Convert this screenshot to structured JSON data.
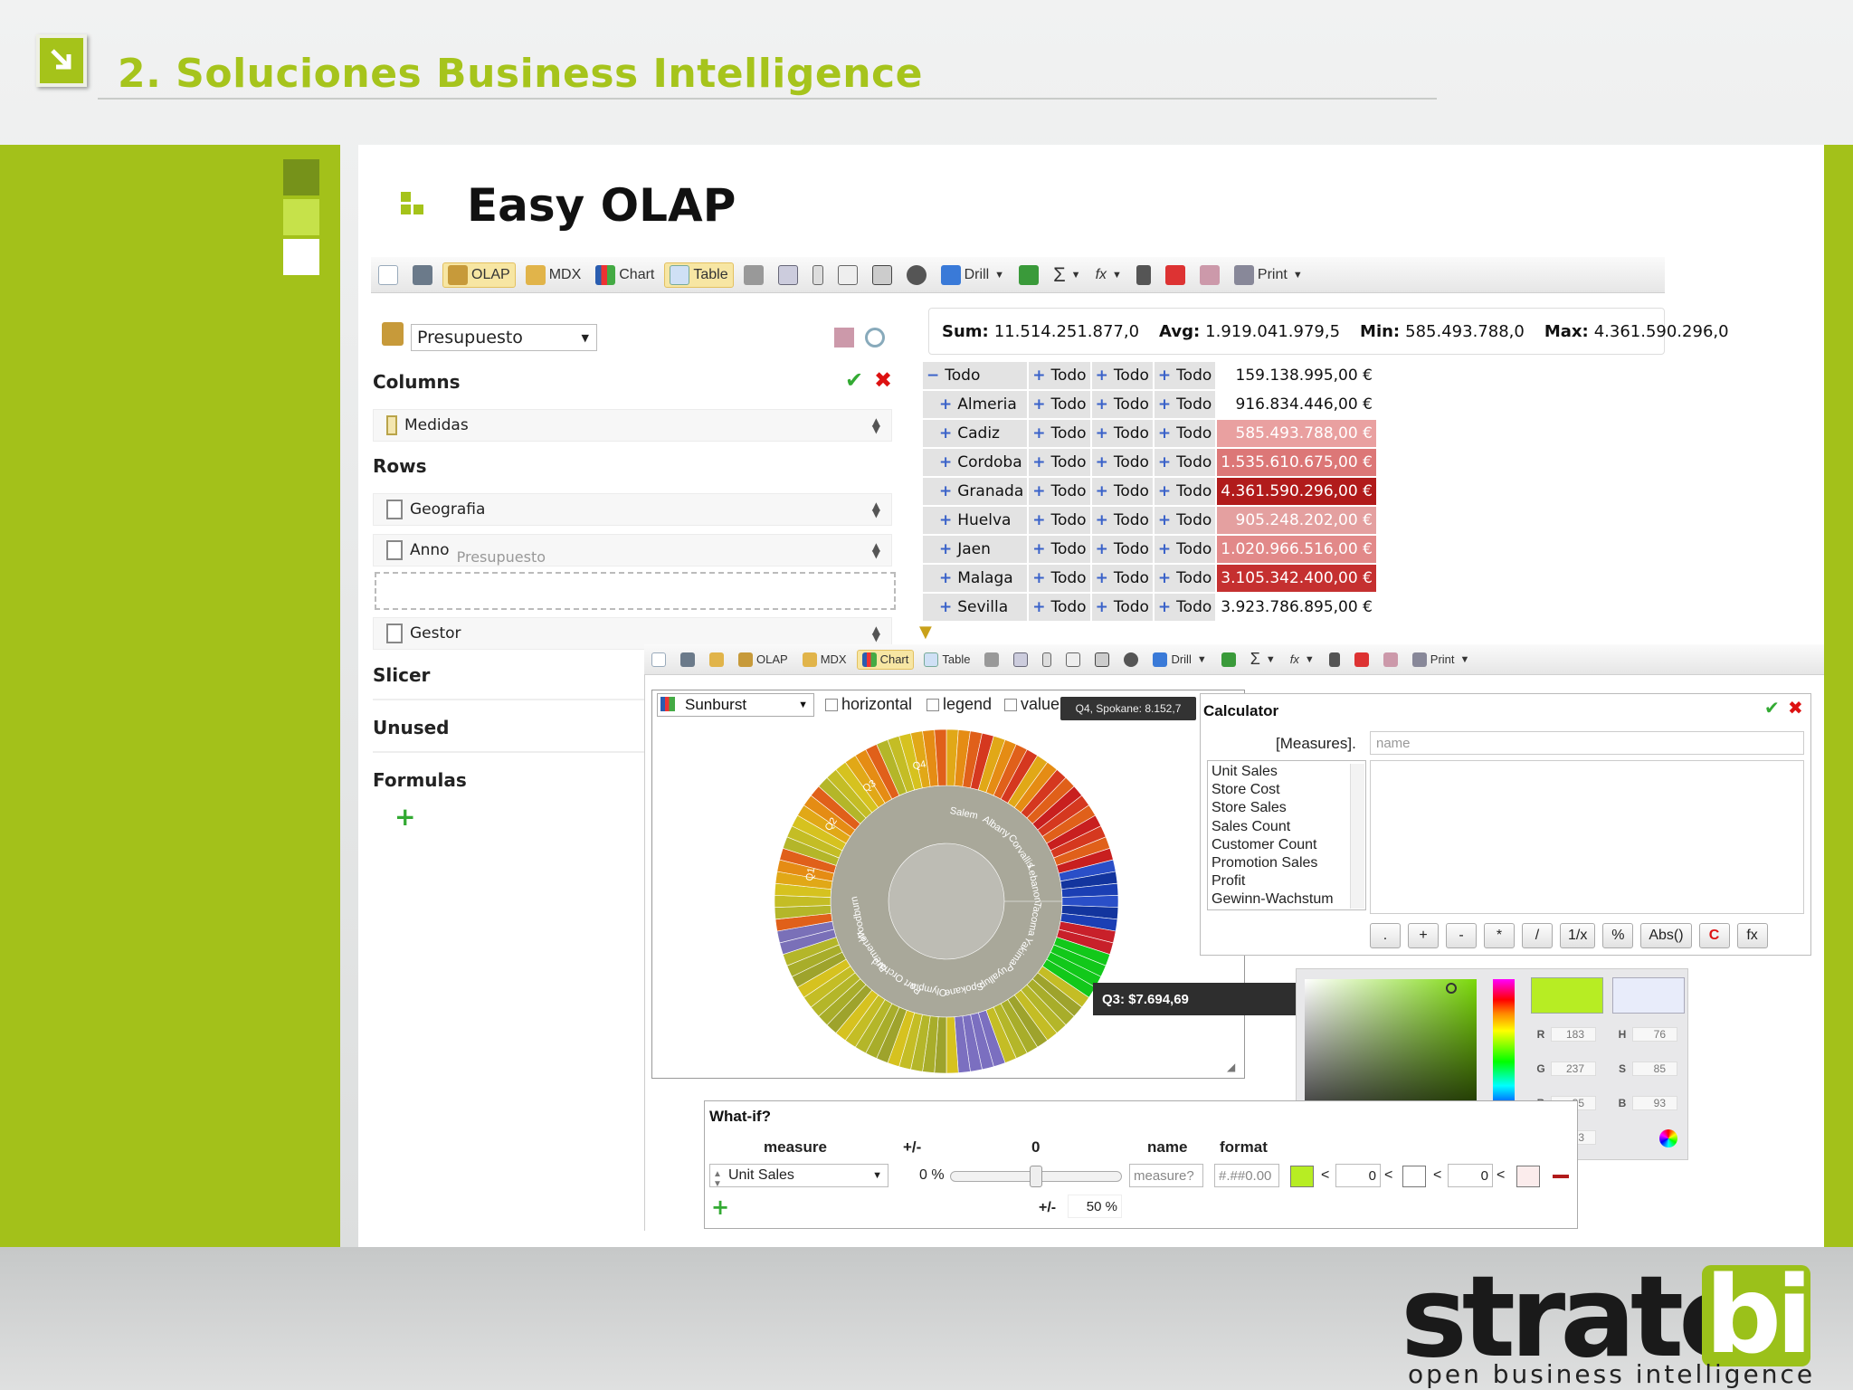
{
  "slide": {
    "section_title": "2. Soluciones Business Intelligence",
    "slide_title": "Easy OLAP",
    "logo": {
      "main": "strate",
      "accent": "bi",
      "tagline": "open business intelligence"
    },
    "colors": {
      "accent": "#a5c31a",
      "dark_red": "#b11b1b",
      "salmon": "#e9a0a0"
    }
  },
  "toolbar_main": {
    "olap": "OLAP",
    "mdx": "MDX",
    "chart": "Chart",
    "table": "Table",
    "drill": "Drill",
    "print": "Print",
    "icons": [
      "new-doc-icon",
      "save-icon",
      "cube-icon",
      "pencil-icon",
      "bar-chart-icon",
      "table-icon",
      "tools-icon",
      "hierarchy-icon",
      "column-icon",
      "layout-icon",
      "grid-icon",
      "swap-icon",
      "drill-icon",
      "export-icon",
      "sigma-icon",
      "fx-icon",
      "calc-icon",
      "whatif-icon",
      "wand-icon",
      "printer-icon"
    ]
  },
  "olap_panel": {
    "cube_select": "Presupuesto",
    "columns_label": "Columns",
    "columns": [
      "Medidas"
    ],
    "rows_label": "Rows",
    "rows": [
      "Geografia",
      "Anno",
      "Gestor"
    ],
    "drag_ghost": "Presupuesto",
    "slicer_label": "Slicer",
    "unused_label": "Unused",
    "formulas_label": "Formulas"
  },
  "stats": {
    "sum_label": "Sum:",
    "sum": "11.514.251.877,0",
    "avg_label": "Avg:",
    "avg": "1.919.041.979,5",
    "min_label": "Min:",
    "min": "585.493.788,0",
    "max_label": "Max:",
    "max": "4.361.590.296,0"
  },
  "pivot": {
    "rows": [
      {
        "c1": "Todo",
        "c2": "Todo",
        "c3": "Todo",
        "c4": "Todo",
        "value": "159.138.995,00 €",
        "bg": "#ffffff",
        "fg": "#111111",
        "minus": true
      },
      {
        "c1": "Almeria",
        "c2": "Todo",
        "c3": "Todo",
        "c4": "Todo",
        "value": "916.834.446,00 €",
        "bg": "#ffffff",
        "fg": "#111111"
      },
      {
        "c1": "Cadiz",
        "c2": "Todo",
        "c3": "Todo",
        "c4": "Todo",
        "value": "585.493.788,00 €",
        "bg": "#e9a0a0",
        "fg": "#ffffff"
      },
      {
        "c1": "Cordoba",
        "c2": "Todo",
        "c3": "Todo",
        "c4": "Todo",
        "value": "1.535.610.675,00 €",
        "bg": "#dc7777",
        "fg": "#ffffff"
      },
      {
        "c1": "Granada",
        "c2": "Todo",
        "c3": "Todo",
        "c4": "Todo",
        "value": "4.361.590.296,00 €",
        "bg": "#b11b1b",
        "fg": "#ffffff"
      },
      {
        "c1": "Huelva",
        "c2": "Todo",
        "c3": "Todo",
        "c4": "Todo",
        "value": "905.248.202,00 €",
        "bg": "#e4a0a0",
        "fg": "#ffffff"
      },
      {
        "c1": "Jaen",
        "c2": "Todo",
        "c3": "Todo",
        "c4": "Todo",
        "value": "1.020.966.516,00 €",
        "bg": "#e28989",
        "fg": "#ffffff"
      },
      {
        "c1": "Malaga",
        "c2": "Todo",
        "c3": "Todo",
        "c4": "Todo",
        "value": "3.105.342.400,00 €",
        "bg": "#c53030",
        "fg": "#ffffff"
      },
      {
        "c1": "Sevilla",
        "c2": "Todo",
        "c3": "Todo",
        "c4": "Todo",
        "value": "3.923.786.895,00 €",
        "bg": "#ffffff",
        "fg": "#111111"
      }
    ]
  },
  "chart_window": {
    "chart_type": "Sunburst",
    "horizontal": "horizontal",
    "legend": "legend",
    "values": "value",
    "tooltip_top": "Q4, Spokane: 8.152,7",
    "tooltip_hover": "Q3: $7.694,69",
    "sunburst_labels": [
      "Salem",
      "Albany",
      "Corvallis",
      "Lebanon",
      "Tacoma",
      "Yakima",
      "Puyallup",
      "Spokane",
      "Olympia",
      "Port Orchard",
      "Bremerton",
      "Woodburn",
      "Q1",
      "Q2",
      "Q3",
      "Q4"
    ]
  },
  "calculator": {
    "title": "Calculator",
    "namespace": "[Measures].",
    "name_placeholder": "name",
    "measures": [
      "Unit Sales",
      "Store Cost",
      "Store Sales",
      "Sales Count",
      "Customer Count",
      "Promotion Sales",
      "Profit",
      "Gewinn-Wachstum"
    ],
    "buttons": [
      ".",
      "+",
      "-",
      "*",
      "/",
      "1/x",
      "%",
      "Abs()",
      "C",
      "fx"
    ]
  },
  "color_picker": {
    "new_color": "#b7ed23",
    "old_color": "#e8ecfa",
    "R_label": "R",
    "R": "183",
    "G_label": "G",
    "G": "237",
    "B_label": "B",
    "B": "35",
    "H_label": "H",
    "H": "76",
    "S_label": "S",
    "S": "85",
    "V_label": "B",
    "V": "93",
    "hex_label": "#",
    "hex": "b7ed23"
  },
  "whatif": {
    "title": "What-if?",
    "h_measure": "measure",
    "h_pm": "+/-",
    "h_zero": "0",
    "h_name": "name",
    "h_format": "format",
    "measure": "Unit Sales",
    "pct": "0 %",
    "name_ph": "measure?",
    "format_ph": "#.##0.00",
    "lt": "<",
    "v1": "0",
    "v2": "0",
    "pm2": "+/-",
    "pct2": "50 %"
  }
}
